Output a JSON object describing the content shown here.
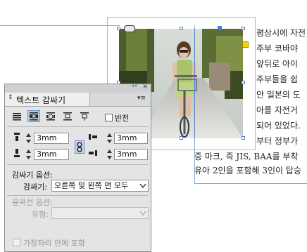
{
  "document": {
    "body_lines": [
      "평상시에 자전",
      "주부 코바야",
      "앞뒤로 아이",
      "주부들을 쉽",
      "안 일본의 도",
      "아를 자전거",
      "되어 있었다.",
      "부터 정부가",
      "증 마크, 즉 JIS, BAA를 부착",
      "유아 2인을 포함해 3인이 탑승"
    ]
  },
  "panel": {
    "title": "텍스트 감싸기",
    "collapse_glyph": "‹‹",
    "close_glyph": "×",
    "menu_glyph": "▾≡",
    "invert_label": "반전",
    "offsets": {
      "top": "3mm",
      "bottom": "3mm",
      "left": "3mm",
      "right": "3mm"
    },
    "wrap_options_label": "감싸기 옵션:",
    "wrap_to_label": "감싸기:",
    "wrap_to_value": "오른쪽 및 왼쪽 면 모두",
    "contour_options_label": "윤곽선 옵션:",
    "type_label": "유형:",
    "type_value": "",
    "include_inside_edges_label": "가장자리 안에 포함"
  },
  "colors": {
    "guide": "#7ea6d8",
    "selection": "#3d7ff0",
    "panel_bg": "#e4e4e4"
  }
}
